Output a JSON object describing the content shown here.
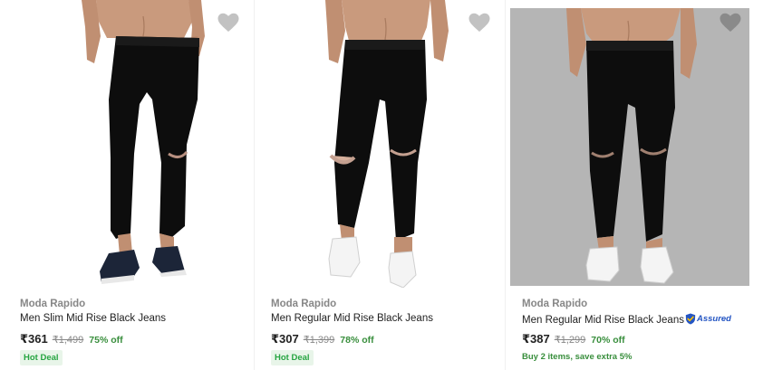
{
  "theme": {
    "accent": "#2874f0",
    "discount_green": "#388e3c",
    "muted": "#878787",
    "assured_blue": "#2455c3"
  },
  "products": [
    {
      "brand": "Moda Rapido",
      "title": "Men Slim Mid Rise Black Jeans",
      "price": "₹361",
      "mrp": "₹1,499",
      "discount": "75% off",
      "tag": "Hot Deal",
      "wishlist_icon": "heart-icon",
      "image_bg": "white"
    },
    {
      "brand": "Moda Rapido",
      "title": "Men Regular Mid Rise Black Jeans",
      "price": "₹307",
      "mrp": "₹1,399",
      "discount": "78% off",
      "tag": "Hot Deal",
      "wishlist_icon": "heart-icon",
      "image_bg": "white"
    },
    {
      "brand": "Moda Rapido",
      "title": "Men Regular Mid Rise Black Jeans",
      "assured_label": "Assured",
      "assured_icon": "assured-shield-icon",
      "price": "₹387",
      "mrp": "₹1,299",
      "discount": "70% off",
      "offer": "Buy 2 items, save extra 5%",
      "wishlist_icon": "heart-icon",
      "image_bg": "grey"
    }
  ]
}
